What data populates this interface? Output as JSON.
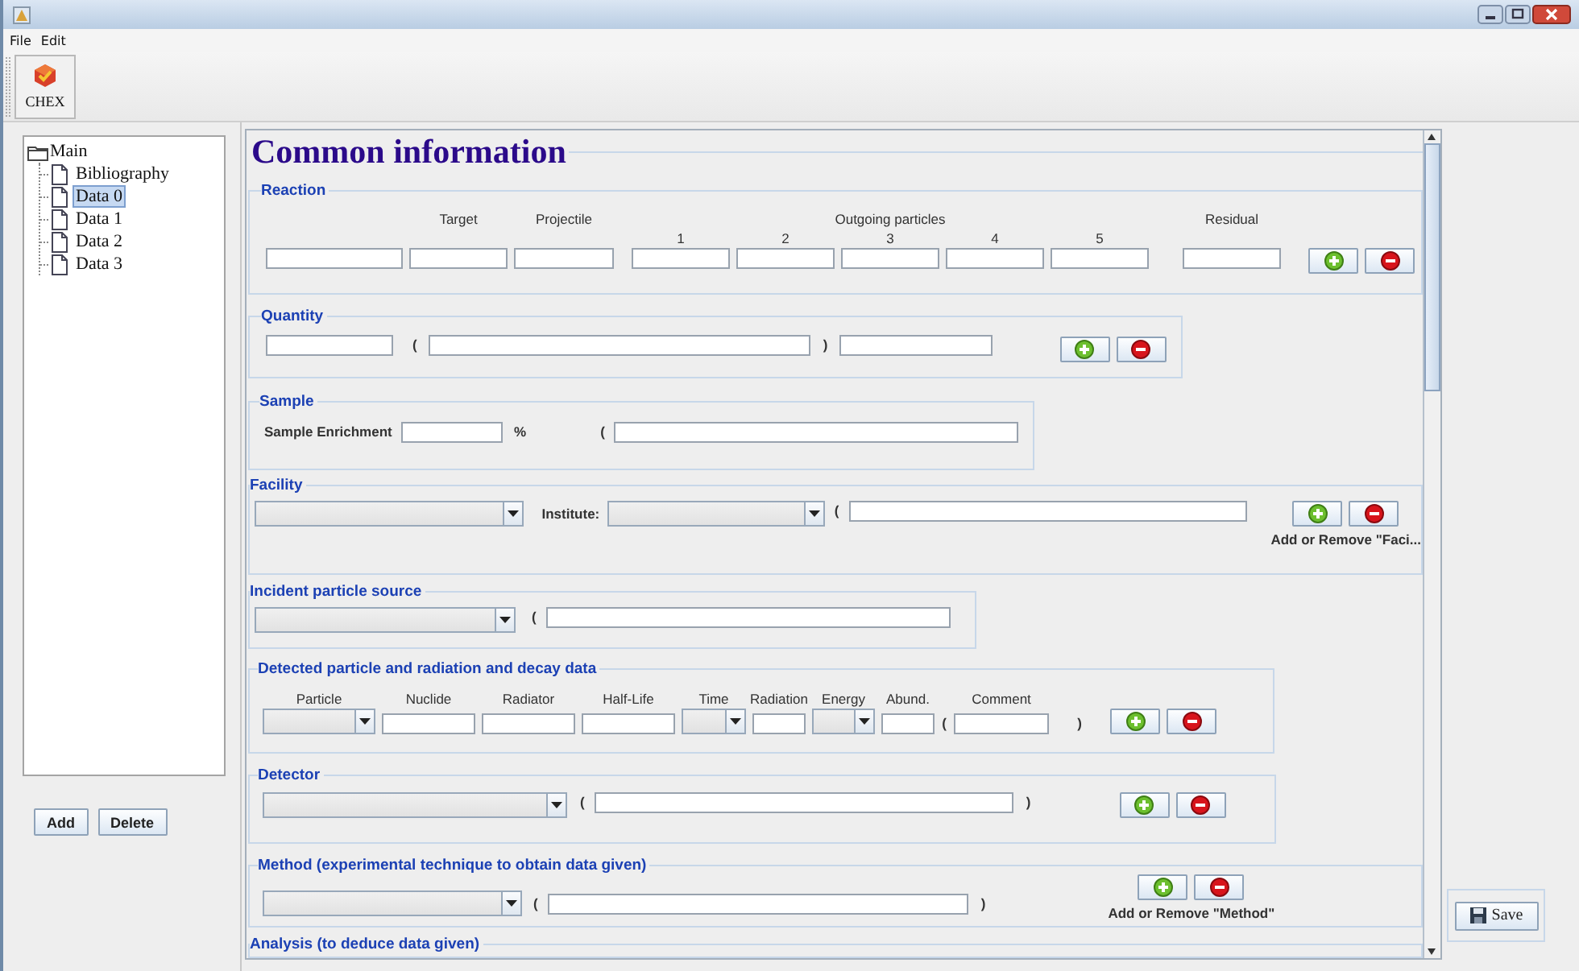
{
  "menu": [
    {
      "label": "File"
    },
    {
      "label": "Edit"
    }
  ],
  "toolbar": [
    {
      "label": "CHEX"
    }
  ],
  "tree": {
    "label": "Main",
    "expanded": true,
    "children": [
      {
        "label": "Bibliography",
        "selected": false
      },
      {
        "label": "Data 0",
        "selected": true
      },
      {
        "label": "Data 1",
        "selected": false
      },
      {
        "label": "Data 2",
        "selected": false
      },
      {
        "label": "Data 3",
        "selected": false
      }
    ]
  },
  "tree_buttons": [
    {
      "label": "Add"
    },
    {
      "label": "Delete"
    }
  ],
  "form": {
    "title": "Common information",
    "sections": [
      {
        "kind": "reaction",
        "legend": "Reaction",
        "headers": [
          "Target",
          "Projectile",
          "Outgoing particles",
          "Residual"
        ],
        "numbers": [
          "1",
          "2",
          "3",
          "4",
          "5"
        ],
        "controls": [
          {
            "kind": "input"
          },
          {
            "kind": "input"
          },
          {
            "kind": "input"
          },
          {
            "kind": "input"
          },
          {
            "kind": "input"
          },
          {
            "kind": "input"
          },
          {
            "kind": "input"
          },
          {
            "kind": "input"
          },
          {
            "kind": "input"
          },
          {
            "kind": "add"
          },
          {
            "kind": "remove"
          }
        ]
      },
      {
        "kind": "quantity",
        "legend": "Quantity",
        "controls": [
          {
            "kind": "input"
          },
          {
            "kind": "text",
            "text": "("
          },
          {
            "kind": "input"
          },
          {
            "kind": "text",
            "text": ")"
          },
          {
            "kind": "input"
          },
          {
            "kind": "add"
          },
          {
            "kind": "remove"
          }
        ]
      },
      {
        "kind": "sample",
        "legend": "Sample",
        "controls": [
          {
            "kind": "text",
            "text": "Sample Enrichment"
          },
          {
            "kind": "input"
          },
          {
            "kind": "text",
            "text": "%"
          },
          {
            "kind": "text",
            "text": "("
          },
          {
            "kind": "input"
          }
        ]
      },
      {
        "kind": "facility",
        "legend": "Facility",
        "controls": [
          {
            "kind": "select"
          },
          {
            "kind": "text",
            "text": "Institute:"
          },
          {
            "kind": "select"
          },
          {
            "kind": "text",
            "text": "("
          },
          {
            "kind": "input"
          },
          {
            "kind": "add"
          },
          {
            "kind": "remove"
          }
        ],
        "note": "Add or Remove \"Faci..."
      },
      {
        "kind": "incident",
        "legend": "Incident particle source",
        "controls": [
          {
            "kind": "select"
          },
          {
            "kind": "text",
            "text": "("
          },
          {
            "kind": "input"
          }
        ]
      },
      {
        "kind": "detected",
        "legend": "Detected particle and radiation and decay data",
        "headers": [
          "Particle",
          "Nuclide",
          "Radiator",
          "Half-Life",
          "Time",
          "Radiation",
          "Energy",
          "Abund.",
          "Comment"
        ],
        "controls": [
          {
            "kind": "select"
          },
          {
            "kind": "input"
          },
          {
            "kind": "input"
          },
          {
            "kind": "input"
          },
          {
            "kind": "select"
          },
          {
            "kind": "input"
          },
          {
            "kind": "select"
          },
          {
            "kind": "input"
          },
          {
            "kind": "text",
            "text": "("
          },
          {
            "kind": "input"
          },
          {
            "kind": "text",
            "text": ")"
          },
          {
            "kind": "add"
          },
          {
            "kind": "remove"
          }
        ]
      },
      {
        "kind": "detector",
        "legend": "Detector",
        "controls": [
          {
            "kind": "select"
          },
          {
            "kind": "text",
            "text": "("
          },
          {
            "kind": "input"
          },
          {
            "kind": "text",
            "text": ")"
          },
          {
            "kind": "add"
          },
          {
            "kind": "remove"
          }
        ]
      },
      {
        "kind": "method",
        "legend": "Method (experimental technique to obtain data given)",
        "controls": [
          {
            "kind": "select"
          },
          {
            "kind": "text",
            "text": "("
          },
          {
            "kind": "input"
          },
          {
            "kind": "text",
            "text": ")"
          },
          {
            "kind": "add"
          },
          {
            "kind": "remove"
          }
        ],
        "note": "Add or Remove \"Method\""
      },
      {
        "kind": "analysis",
        "legend": "Analysis (to deduce data given)"
      }
    ]
  },
  "save_button": {
    "label": "Save"
  }
}
